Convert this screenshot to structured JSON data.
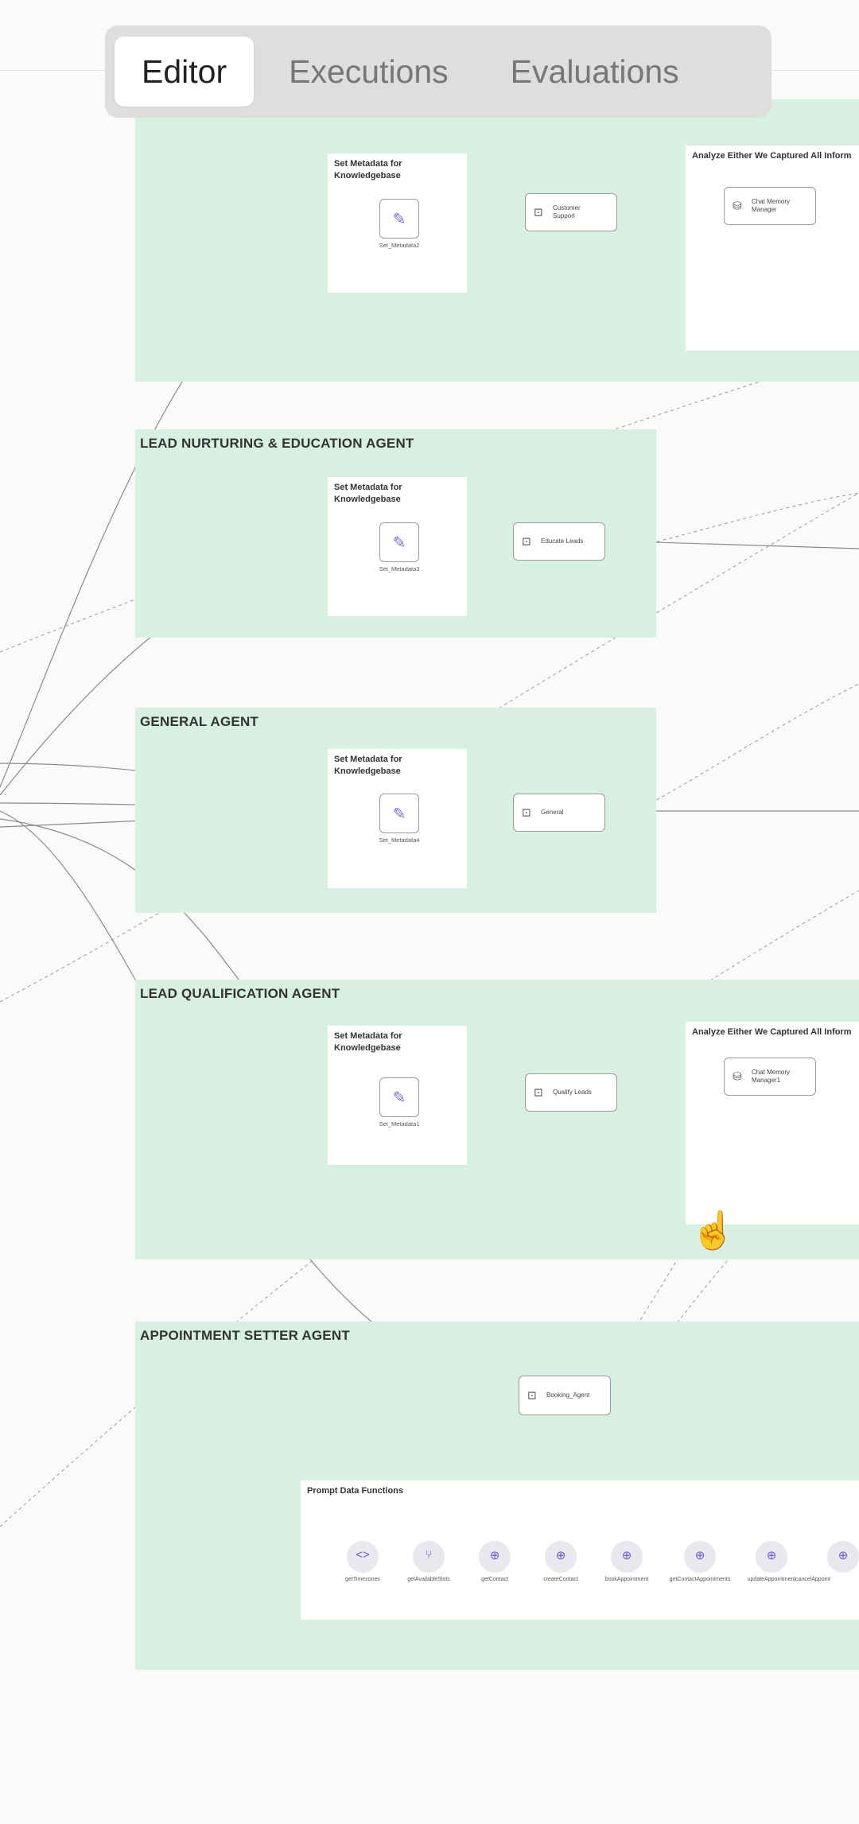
{
  "tabs": [
    {
      "label": "Editor",
      "active": true
    },
    {
      "label": "Executions",
      "active": false
    },
    {
      "label": "Evaluations",
      "active": false
    }
  ],
  "colors": {
    "group_bg": "#d7f0e1",
    "accent_purple": "#7c6fd6"
  },
  "groups": {
    "lead_nurturing": {
      "label": "LEAD NURTURING & EDUCATION AGENT"
    },
    "general": {
      "label": "GENERAL AGENT"
    },
    "lead_qualification": {
      "label": "LEAD QUALIFICATION AGENT"
    },
    "appointment_setter": {
      "label": "APPOINTMENT SETTER AGENT"
    }
  },
  "notes": {
    "metadata": "Set Metadata for Knowledgebase",
    "analyze": "Analyze Either We Captured All Inform",
    "prompt_data": "Prompt Data Functions"
  },
  "nodes": {
    "set_metadata_1": {
      "caption": "Set_Metadata2"
    },
    "set_metadata_2": {
      "caption": "Set_Metadata3"
    },
    "set_metadata_3": {
      "caption": "Set_Metadata4"
    },
    "set_metadata_4": {
      "caption": "Set_Metadata1"
    },
    "customer_support": {
      "label": "Customer Support"
    },
    "chat_memory_1": {
      "label": "Chat Memory Manager"
    },
    "educate_leads": {
      "label": "Educate Leads"
    },
    "general_agent": {
      "label": "General"
    },
    "qualify_leads": {
      "label": "Qualify Leads"
    },
    "chat_memory_2": {
      "label": "Chat Memory Manager1"
    },
    "booking_agent": {
      "label": "Booking_Agent"
    }
  },
  "functions": [
    {
      "name": "getTimezones",
      "icon": "code-icon",
      "glyph": "<>"
    },
    {
      "name": "getAvailableSlots",
      "icon": "branch-icon",
      "glyph": "⑂"
    },
    {
      "name": "getContact",
      "icon": "globe-icon",
      "glyph": "⊕"
    },
    {
      "name": "createContact",
      "icon": "globe-icon",
      "glyph": "⊕"
    },
    {
      "name": "bookAppointment",
      "icon": "globe-icon",
      "glyph": "⊕"
    },
    {
      "name": "getContactAppointments",
      "icon": "globe-icon",
      "glyph": "⊕"
    },
    {
      "name": "updateAppointment",
      "icon": "globe-icon",
      "glyph": "⊕"
    },
    {
      "name": "cancelAppoint",
      "icon": "globe-icon",
      "glyph": "⊕"
    }
  ]
}
